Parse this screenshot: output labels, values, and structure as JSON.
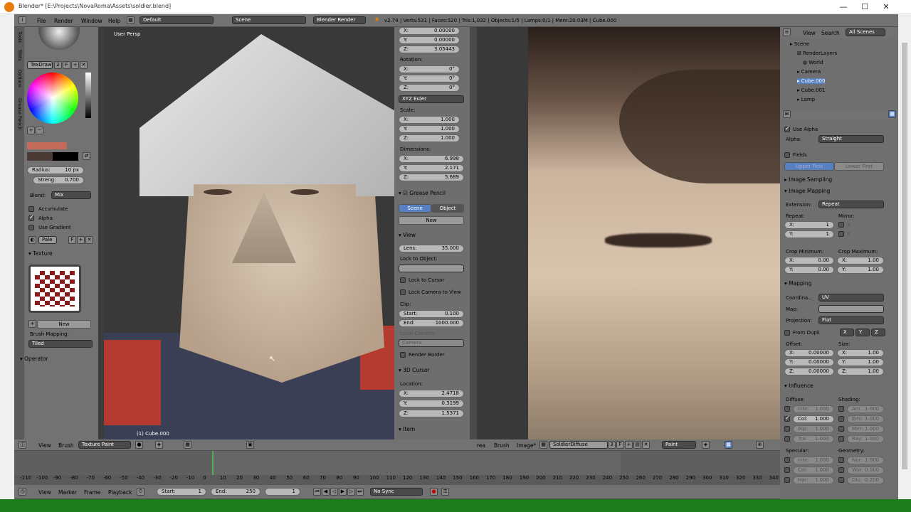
{
  "window": {
    "title": "Blender* [E:\\Projects\\NovaRoma\\Assets\\soldier.blend]",
    "min": "—",
    "max": "☐",
    "close": "✕"
  },
  "topbar": {
    "menus": [
      "File",
      "Render",
      "Window",
      "Help"
    ],
    "layout": "Default",
    "scene": "Scene",
    "engine": "Blender Render",
    "stats": "v2.74 | Verts:531 | Faces:520 | Tris:1,032 | Objects:1/5 | Lamps:0/1 | Mem:20.03M | Cube.000"
  },
  "toolshelf": {
    "tabs": [
      "Tools",
      "Slots",
      "Options",
      "Grease Pencil"
    ],
    "brush_name": "TexDraw",
    "brush_users": "2",
    "brush_f": "F",
    "radius": {
      "label": "Radius:",
      "value": "10 px"
    },
    "strength": {
      "label": "Streng:",
      "value": "0.700"
    },
    "blend": {
      "label": "Blend:",
      "value": "Mix"
    },
    "accumulate": "Accumulate",
    "alpha": "Alpha",
    "use_gradient": "Use Gradient",
    "palette": "Pale",
    "palette_f": "F",
    "texture_header": "Texture",
    "new_btn": "New",
    "brush_mapping": "Brush Mapping:",
    "mapping_value": "Tiled",
    "operator": "Operator"
  },
  "viewport": {
    "label": "User Persp",
    "object": "(1) Cube.000"
  },
  "npanel": {
    "loc": [
      {
        "axis": "X:",
        "value": "0.00000"
      },
      {
        "axis": "Y:",
        "value": "0.00000"
      },
      {
        "axis": "Z:",
        "value": "3.05443"
      }
    ],
    "rotation_label": "Rotation:",
    "rot": [
      {
        "axis": "X:",
        "value": "0°"
      },
      {
        "axis": "Y:",
        "value": "0°"
      },
      {
        "axis": "Z:",
        "value": "0°"
      }
    ],
    "rot_mode": "XYZ Euler",
    "scale_label": "Scale:",
    "scale": [
      {
        "axis": "X:",
        "value": "1.000"
      },
      {
        "axis": "Y:",
        "value": "1.000"
      },
      {
        "axis": "Z:",
        "value": "1.000"
      }
    ],
    "dim_label": "Dimensions:",
    "dim": [
      {
        "axis": "X:",
        "value": "6.998"
      },
      {
        "axis": "Y:",
        "value": "2.171"
      },
      {
        "axis": "Z:",
        "value": "5.689"
      }
    ],
    "grease_pencil": "Grease Pencil",
    "scene_btn": "Scene",
    "object_btn": "Object",
    "new_btn": "New",
    "view_header": "View",
    "lens_label": "Lens:",
    "lens_value": "35.000",
    "lock_to_object": "Lock to Object:",
    "lock_to_cursor": "Lock to Cursor",
    "lock_camera": "Lock Camera to View",
    "clip_label": "Clip:",
    "clip_start_label": "Start:",
    "clip_start": "0.100",
    "clip_end_label": "End:",
    "clip_end": "1000.000",
    "local_camera": "Local Camera:",
    "camera": "Camera",
    "render_border": "Render Border",
    "cursor_header": "3D Cursor",
    "location_label": "Location:",
    "cursor": [
      {
        "axis": "X:",
        "value": "2.4718"
      },
      {
        "axis": "Y:",
        "value": "0.3199"
      },
      {
        "axis": "Z:",
        "value": "1.5371"
      }
    ],
    "item_header": "Item"
  },
  "view3d_header": {
    "view": "View",
    "brush": "Brush",
    "mode": "Texture Paint"
  },
  "image_header": {
    "view": "rea",
    "brush": "Brush",
    "image": "Image*",
    "image_name": "SoldierDiffuse",
    "users": "3",
    "mode": "Paint"
  },
  "outliner": {
    "view": "View",
    "search": "Search",
    "filter": "All Scenes",
    "items": [
      "Scene",
      "RenderLayers",
      "World",
      "Camera",
      "Cube.000",
      "Cube.001",
      "Lamp"
    ]
  },
  "props": {
    "use_alpha": "Use Alpha",
    "alpha_label": "Alpha:",
    "alpha_value": "Straight",
    "fields": "Fields",
    "upper_first": "Upper First",
    "lower_first": "Lower First",
    "image_sampling": "Image Sampling",
    "image_mapping": "Image Mapping",
    "extension_label": "Extension:",
    "extension_value": "Repeat",
    "repeat_label": "Repeat:",
    "mirror_label": "Mirror:",
    "repeat": [
      {
        "axis": "X:",
        "value": "1"
      },
      {
        "axis": "Y:",
        "value": "1"
      }
    ],
    "mirror": [
      "X",
      "Y"
    ],
    "crop_min": "Crop Minimum:",
    "crop_max": "Crop Maximum:",
    "cmin": [
      {
        "axis": "X:",
        "value": "0.00"
      },
      {
        "axis": "Y:",
        "value": "0.00"
      }
    ],
    "cmax": [
      {
        "axis": "X:",
        "value": "1.00"
      },
      {
        "axis": "Y:",
        "value": "1.00"
      }
    ],
    "mapping": "Mapping",
    "coord_label": "Coordina...",
    "coord_value": "UV",
    "map_label": "Map:",
    "proj_label": "Projection:",
    "proj_value": "Flat",
    "from_dupli": "From Dupli",
    "xyz": [
      "X",
      "Y",
      "Z"
    ],
    "offset_label": "Offset:",
    "size_label": "Size:",
    "offset": [
      {
        "axis": "X:",
        "value": "0.00000"
      },
      {
        "axis": "Y:",
        "value": "0.00000"
      },
      {
        "axis": "Z:",
        "value": "0.00000"
      }
    ],
    "size": [
      {
        "axis": "X:",
        "value": "1.00"
      },
      {
        "axis": "Y:",
        "value": "1.00"
      },
      {
        "axis": "Z:",
        "value": "1.00"
      }
    ],
    "influence": "Influence",
    "diffuse": "Diffuse:",
    "shading": "Shading:",
    "diff_items": [
      {
        "label": "Inte:",
        "value": "1.000"
      },
      {
        "label": "Col:",
        "value": "1.000"
      },
      {
        "label": "Alp:",
        "value": "1.000"
      },
      {
        "label": "Tra:",
        "value": "1.000"
      }
    ],
    "shad_items": [
      {
        "label": "Am:",
        "value": "1.000"
      },
      {
        "label": "Emi:",
        "value": "1.000"
      },
      {
        "label": "Mirr:",
        "value": "1.000"
      },
      {
        "label": "Ray:",
        "value": "1.000"
      }
    ],
    "specular": "Specular:",
    "geometry": "Geometry:",
    "spec_items": [
      {
        "label": "Inte:",
        "value": "1.000"
      },
      {
        "label": "Col:",
        "value": "1.000"
      },
      {
        "label": "Har:",
        "value": "1.000"
      }
    ],
    "geo_items": [
      {
        "label": "Nor:",
        "value": "1.000"
      },
      {
        "label": "War:",
        "value": "0.000"
      },
      {
        "label": "Dis:",
        "value": "0.200"
      }
    ]
  },
  "timeline": {
    "ticks": [
      "-110",
      "-100",
      "-90",
      "-80",
      "-70",
      "-60",
      "-50",
      "-40",
      "-30",
      "-20",
      "-10",
      "0",
      "10",
      "20",
      "30",
      "40",
      "50",
      "60",
      "70",
      "80",
      "90",
      "100",
      "110",
      "120",
      "130",
      "140",
      "150",
      "160",
      "170",
      "180",
      "190",
      "200",
      "210",
      "220",
      "230",
      "240",
      "250",
      "260",
      "270",
      "280",
      "290",
      "300",
      "310",
      "320",
      "330",
      "340"
    ],
    "menus": [
      "View",
      "Marker",
      "Frame",
      "Playback"
    ],
    "start_label": "Start:",
    "start": "1",
    "end_label": "End:",
    "end": "250",
    "current": "1",
    "sync": "No Sync"
  }
}
